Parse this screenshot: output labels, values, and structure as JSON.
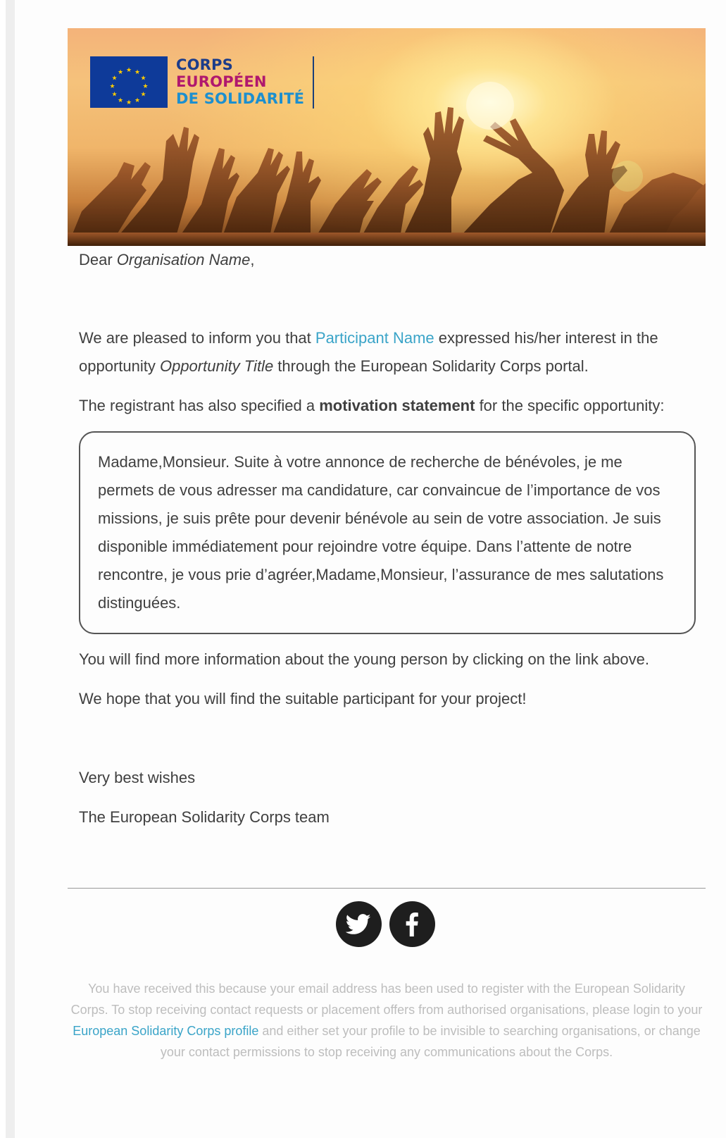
{
  "banner": {
    "logo": {
      "line1": "CORPS",
      "line2": "EUROPÉEN",
      "line3": "DE SOLIDARITÉ"
    }
  },
  "email": {
    "greeting_prefix": "Dear ",
    "organisation_name": "Organisation Name",
    "greeting_suffix": ",",
    "p1_before_link": "We are pleased to inform you that ",
    "participant_name": "Participant Name",
    "p1_after_link": " expressed his/her interest in the opportunity ",
    "opportunity_title": "Opportunity Title",
    "p1_end": " through the European Solidarity Corps portal.",
    "p2_before_bold": "The registrant has also specified a ",
    "p2_bold": "motivation statement",
    "p2_after_bold": " for the specific opportunity:",
    "motivation_statement": "Madame,Monsieur. Suite à votre annonce de recherche de bénévoles, je me permets de vous adresser ma candidature, car convaincue de l’importance de vos missions, je suis prête pour devenir bénévole au sein de votre association. Je suis disponible immédiatement pour rejoindre votre équipe. Dans l’attente de notre rencontre, je vous prie d’agréer,Madame,Monsieur, l’assurance de mes salutations distinguées.",
    "p3": "You will find more information about the young person by clicking on the link above.",
    "p4": "We hope that you will find the suitable participant for your project!",
    "closing": "Very best wishes",
    "signature": "The European Solidarity Corps team"
  },
  "footer": {
    "social_icons": [
      "twitter-icon",
      "facebook-icon"
    ],
    "disclaimer_before_link": "You have received this because your email address has been used to register with the European Solidarity Corps. To stop receiving contact requests or placement offers from authorised organisations, please login to your ",
    "disclaimer_link": "European Solidarity Corps profile",
    "disclaimer_after_link": " and either set your profile to be invisible to searching organisations, or change your contact permissions to stop receiving any communications about the Corps."
  },
  "colors": {
    "link": "#3aa4c8",
    "logo_blue": "#1c3c8a",
    "logo_magenta": "#b0186e",
    "logo_light_blue": "#1c8fcf",
    "eu_flag": "#0e3a99",
    "eu_stars": "#ffcc00",
    "social_bg": "#1e1e1e",
    "disclaimer_text": "#bdbdbd"
  }
}
